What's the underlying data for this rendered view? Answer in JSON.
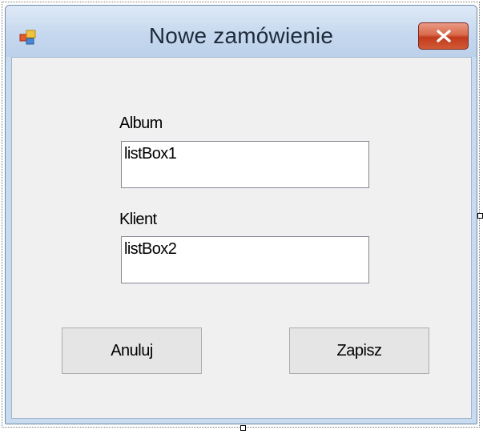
{
  "window": {
    "title": "Nowe zamówienie",
    "app_icon": "windows-form-icon",
    "close_icon": "close-x-icon"
  },
  "form": {
    "album_label": "Album",
    "album_listbox": "listBox1",
    "client_label": "Klient",
    "client_listbox": "listBox2",
    "cancel_button": "Anuluj",
    "save_button": "Zapisz"
  },
  "colors": {
    "client_background": "#f0f0f0",
    "titlebar": "#c6d8ee",
    "close_button": "#c23a1c"
  }
}
